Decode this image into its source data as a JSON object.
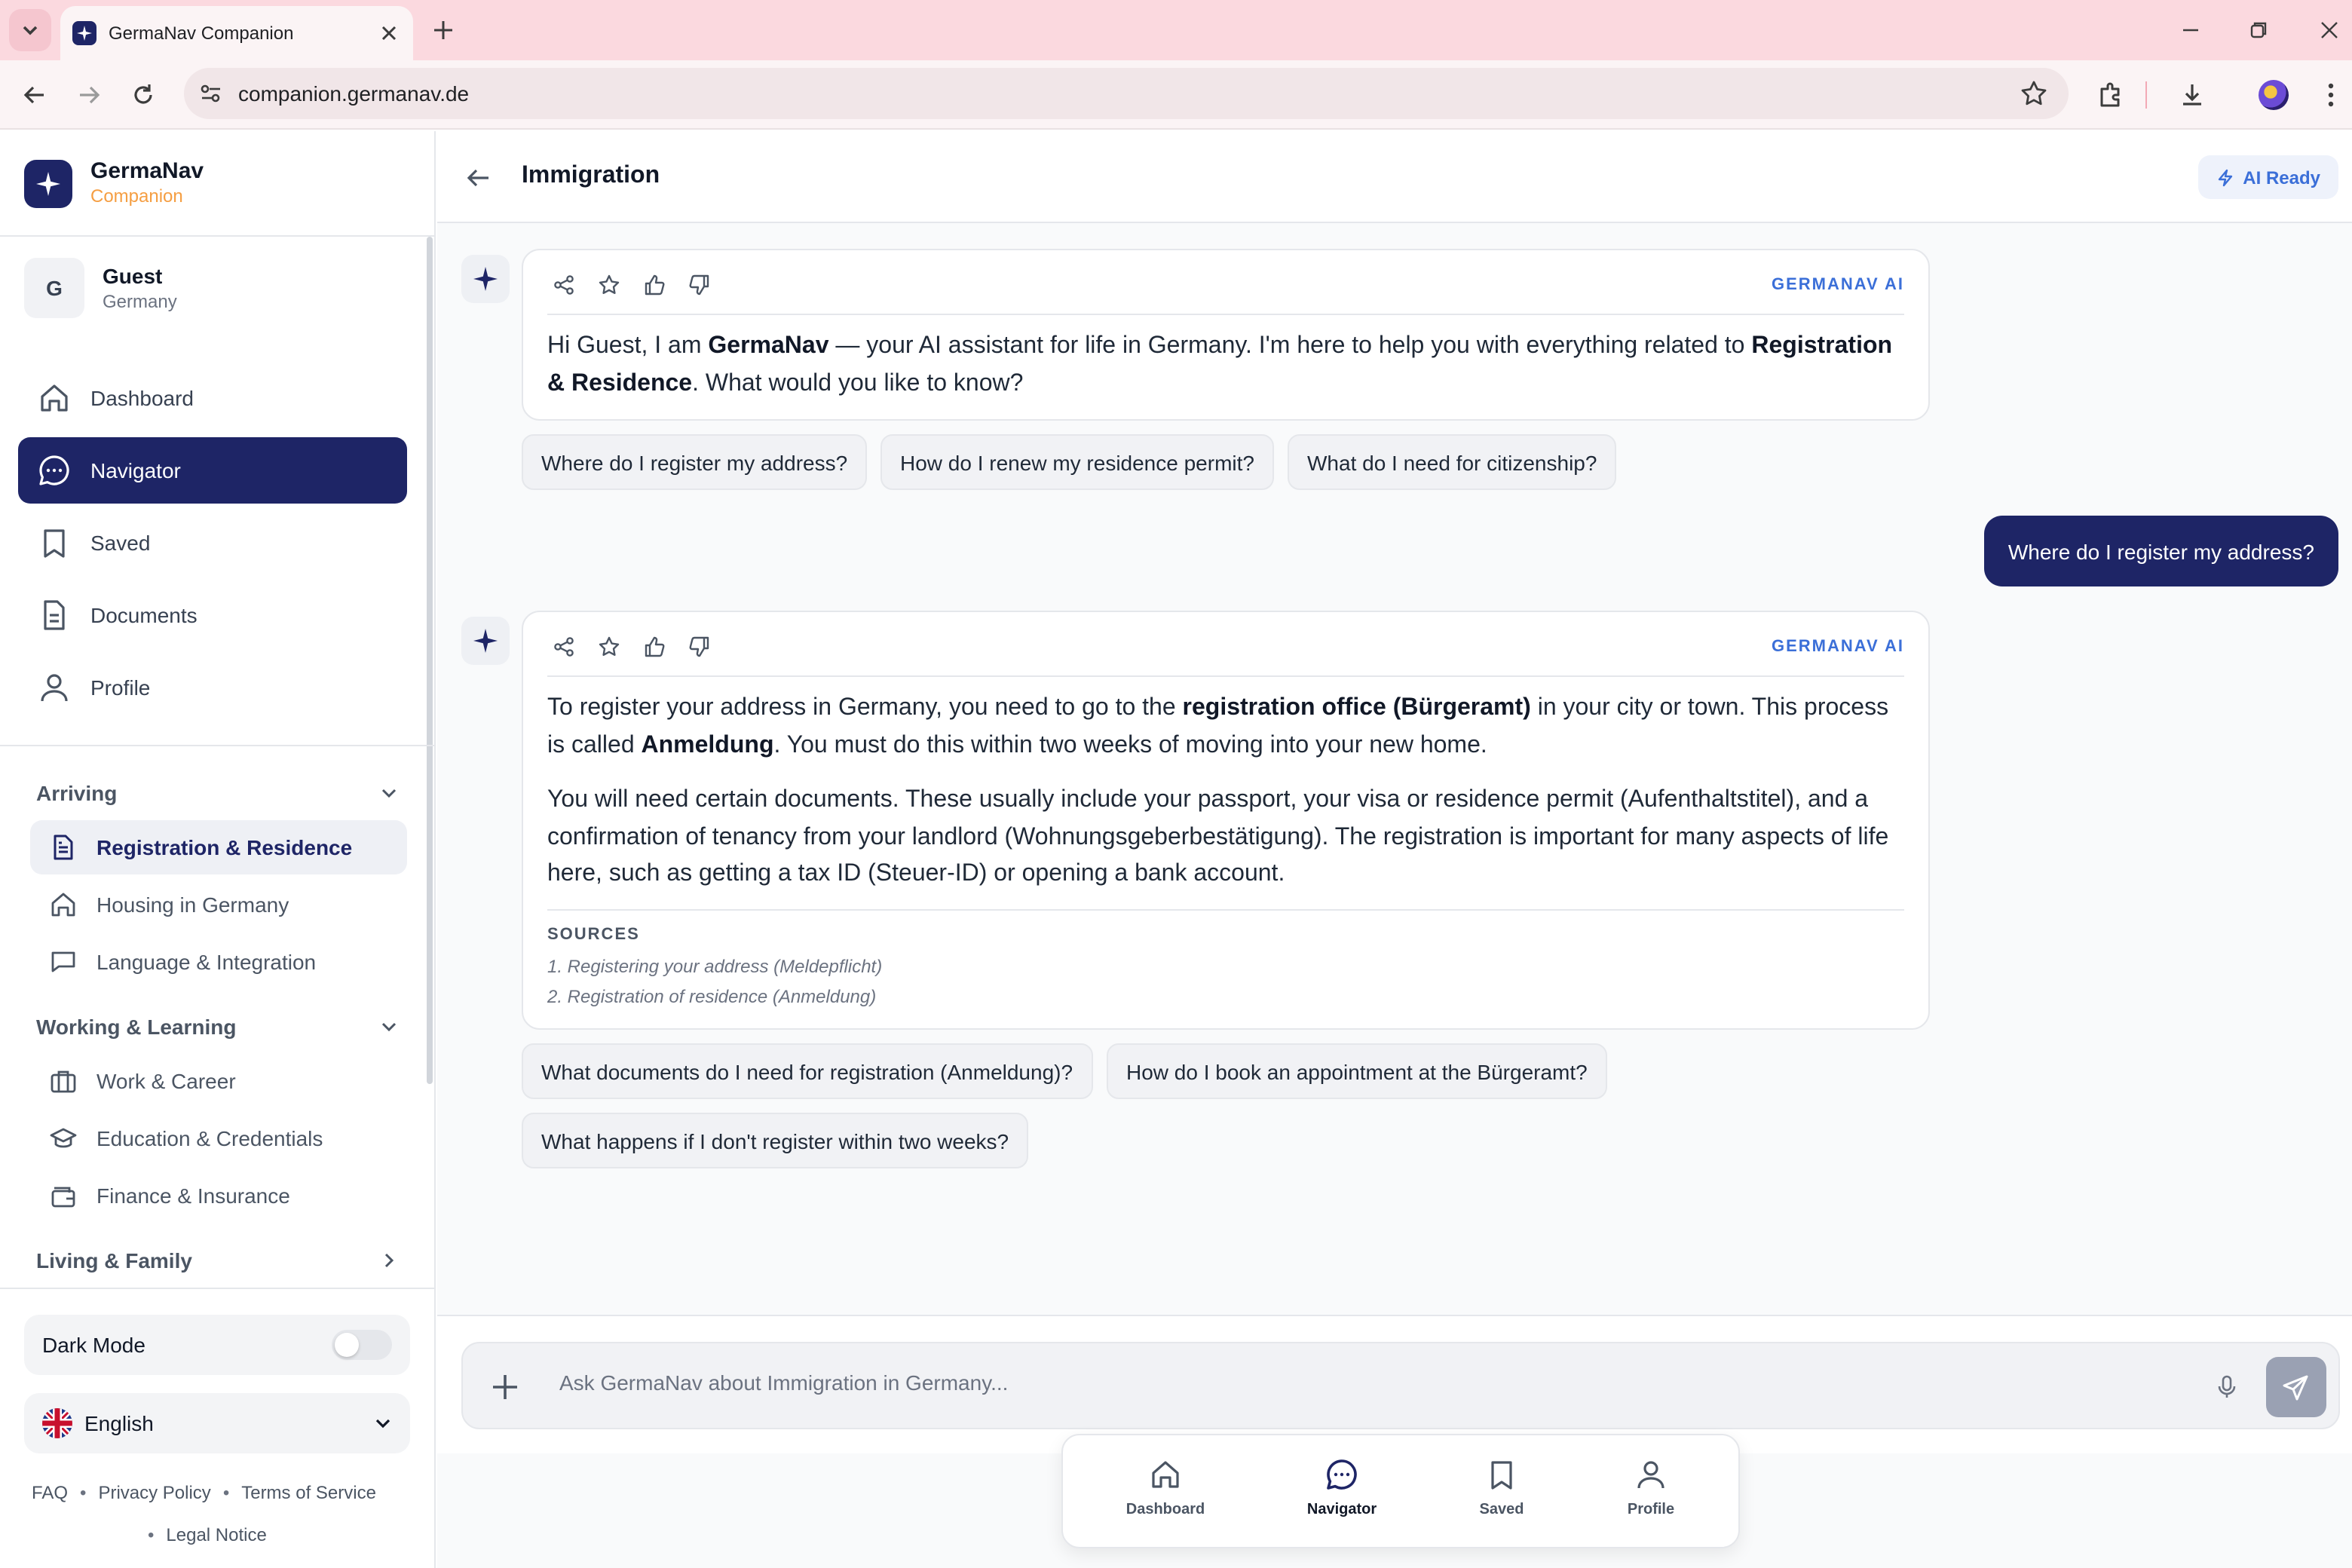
{
  "browser": {
    "tab_title": "GermaNav Companion",
    "url": "companion.germanav.de"
  },
  "brand": {
    "name": "GermaNav",
    "subtitle": "Companion"
  },
  "user": {
    "initial": "G",
    "name": "Guest",
    "location": "Germany"
  },
  "nav": [
    {
      "label": "Dashboard",
      "icon": "home-icon"
    },
    {
      "label": "Navigator",
      "icon": "chat-icon",
      "active": true
    },
    {
      "label": "Saved",
      "icon": "bookmark-icon"
    },
    {
      "label": "Documents",
      "icon": "document-icon"
    },
    {
      "label": "Profile",
      "icon": "user-icon"
    }
  ],
  "sections": {
    "arriving": {
      "label": "Arriving",
      "items": [
        {
          "label": "Registration & Residence",
          "icon": "document-icon",
          "active": true
        },
        {
          "label": "Housing in Germany",
          "icon": "home-icon"
        },
        {
          "label": "Language & Integration",
          "icon": "chat-bubble-icon"
        }
      ]
    },
    "working": {
      "label": "Working & Learning",
      "items": [
        {
          "label": "Work & Career",
          "icon": "briefcase-icon"
        },
        {
          "label": "Education & Credentials",
          "icon": "graduation-cap-icon"
        },
        {
          "label": "Finance & Insurance",
          "icon": "wallet-icon"
        }
      ]
    },
    "living": {
      "label": "Living & Family"
    }
  },
  "settings": {
    "dark_mode_label": "Dark Mode",
    "dark_mode_on": false,
    "language": "English"
  },
  "footer": {
    "faq": "FAQ",
    "privacy": "Privacy Policy",
    "terms": "Terms of Service",
    "legal": "Legal Notice",
    "separator": "•"
  },
  "header": {
    "title": "Immigration",
    "status": "AI Ready"
  },
  "chat": {
    "assistant_tag": "GERMANAV AI",
    "message1": {
      "before": "Hi Guest, I am ",
      "bold1": "GermaNav",
      "middle": " — your AI assistant for life in Germany. I'm here to help you with everything related to ",
      "bold2": "Registration & Residence",
      "after": ". What would you like to know?"
    },
    "suggestions1": [
      "Where do I register my address?",
      "How do I renew my residence permit?",
      "What do I need for citizenship?"
    ],
    "user_message": "Where do I register my address?",
    "message2": {
      "p1_before": "To register your address in Germany, you need to go to the ",
      "p1_bold1": "registration office (Bürgeramt)",
      "p1_middle": " in your city or town. This process is called ",
      "p1_bold2": "Anmeldung",
      "p1_after": ". You must do this within two weeks of moving into your new home.",
      "p2": "You will need certain documents. These usually include your passport, your visa or residence permit (Aufenthaltstitel), and a confirmation of tenancy from your landlord (Wohnungsgeberbestätigung). The registration is important for many aspects of life here, such as getting a tax ID (Steuer-ID) or opening a bank account.",
      "sources_title": "SOURCES",
      "sources": [
        "1. Registering your address (Meldepflicht)",
        "2. Registration of residence (Anmeldung)"
      ]
    },
    "suggestions2": [
      "What documents do I need for registration (Anmeldung)?",
      "How do I book an appointment at the Bürgeramt?",
      "What happens if I don't register within two weeks?"
    ]
  },
  "input": {
    "placeholder": "Ask GermaNav about Immigration in Germany..."
  },
  "bottom_nav": [
    {
      "label": "Dashboard",
      "icon": "home-icon"
    },
    {
      "label": "Navigator",
      "icon": "chat-icon",
      "active": true
    },
    {
      "label": "Saved",
      "icon": "bookmark-icon"
    },
    {
      "label": "Profile",
      "icon": "user-icon"
    }
  ],
  "colors": {
    "primary": "#1e2566",
    "accent": "#f59e42",
    "link": "#3b6fd8",
    "tab_bar": "#fbd9df"
  }
}
